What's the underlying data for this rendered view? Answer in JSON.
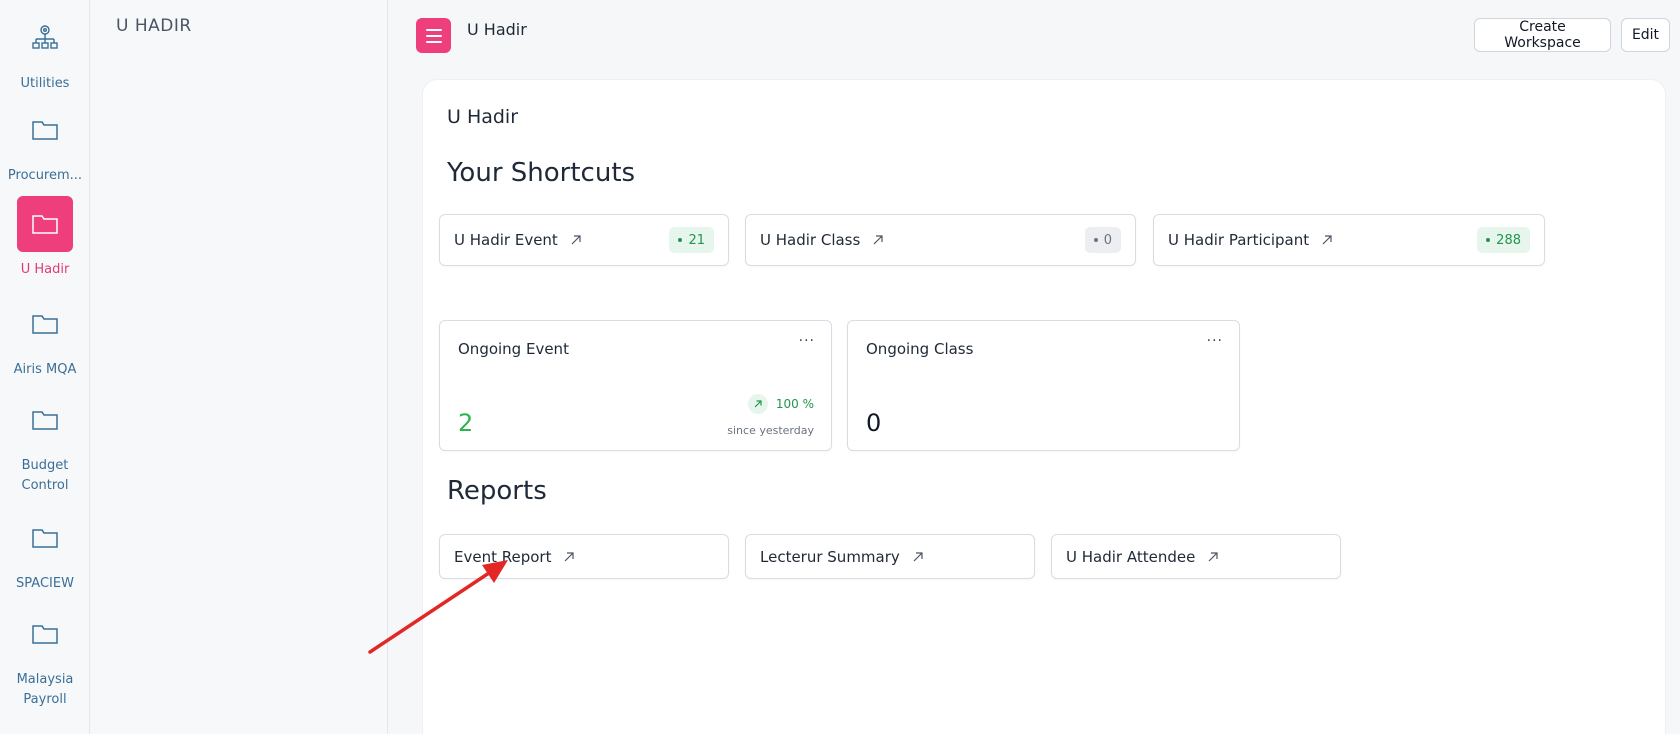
{
  "rail": {
    "items": [
      {
        "label": "Utilities",
        "icon": "org-chart-icon",
        "active": false
      },
      {
        "label": "Procurem...",
        "icon": "folder-icon",
        "active": false
      },
      {
        "label": "U Hadir",
        "icon": "folder-icon",
        "active": true
      },
      {
        "label": "Airis MQA",
        "icon": "folder-icon",
        "active": false
      },
      {
        "label": "Budget Control",
        "icon": "folder-icon",
        "active": false
      },
      {
        "label": "SPACIEW",
        "icon": "folder-icon",
        "active": false
      },
      {
        "label": "Malaysia Payroll",
        "icon": "folder-icon",
        "active": false
      }
    ]
  },
  "panel": {
    "title": "U HADIR"
  },
  "header": {
    "title": "U Hadir",
    "create_workspace_label": "Create Workspace",
    "edit_label": "Edit"
  },
  "main": {
    "title": "U Hadir",
    "shortcuts_title": "Your Shortcuts",
    "shortcuts": [
      {
        "label": "U Hadir Event",
        "count": "21",
        "badge": "green"
      },
      {
        "label": "U Hadir Class",
        "count": "0",
        "badge": "gray"
      },
      {
        "label": "U Hadir Participant",
        "count": "288",
        "badge": "green"
      }
    ],
    "number_cards": [
      {
        "title": "Ongoing Event",
        "value": "2",
        "trend_pct": "100 %",
        "trend_since": "since yesterday",
        "menu": "..."
      },
      {
        "title": "Ongoing Class",
        "value": "0",
        "menu": "..."
      }
    ],
    "reports_title": "Reports",
    "reports": [
      {
        "label": "Event Report"
      },
      {
        "label": "Lecterur Summary"
      },
      {
        "label": "U Hadir Attendee"
      }
    ]
  },
  "colors": {
    "accent": "#ee3f7c",
    "success": "#23944d",
    "annotation_arrow": "#e32626"
  }
}
